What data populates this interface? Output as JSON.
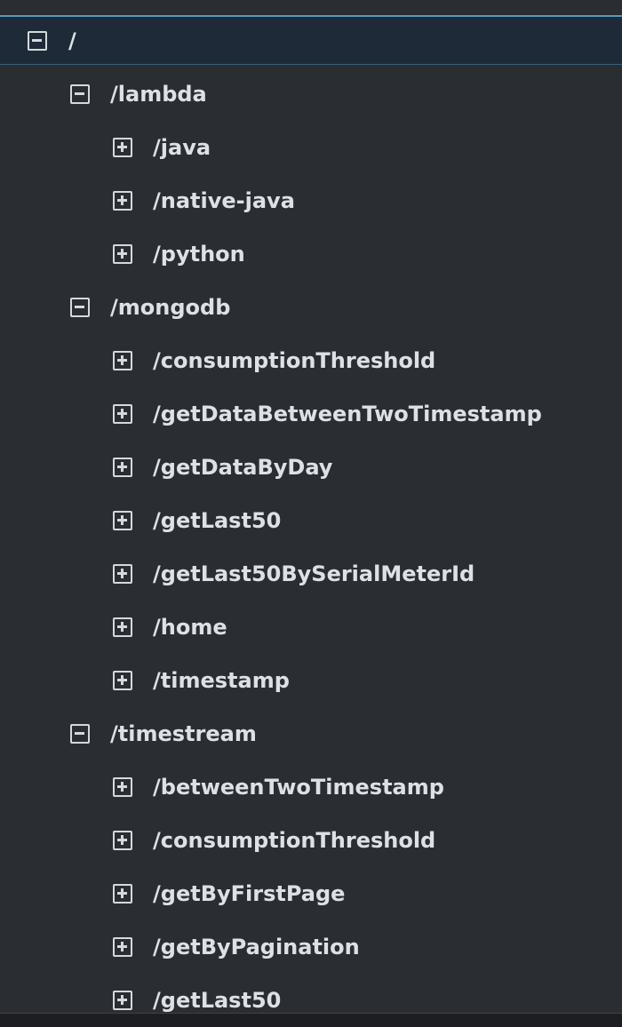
{
  "tree": {
    "nodes": [
      {
        "label": "/",
        "level": 0,
        "expanded": true,
        "selected": true
      },
      {
        "label": "/lambda",
        "level": 1,
        "expanded": true
      },
      {
        "label": "/java",
        "level": 2,
        "expanded": false
      },
      {
        "label": "/native-java",
        "level": 2,
        "expanded": false
      },
      {
        "label": "/python",
        "level": 2,
        "expanded": false
      },
      {
        "label": "/mongodb",
        "level": 1,
        "expanded": true
      },
      {
        "label": "/consumptionThreshold",
        "level": 2,
        "expanded": false
      },
      {
        "label": "/getDataBetweenTwoTimestamp",
        "level": 2,
        "expanded": false
      },
      {
        "label": "/getDataByDay",
        "level": 2,
        "expanded": false
      },
      {
        "label": "/getLast50",
        "level": 2,
        "expanded": false
      },
      {
        "label": "/getLast50BySerialMeterId",
        "level": 2,
        "expanded": false
      },
      {
        "label": "/home",
        "level": 2,
        "expanded": false
      },
      {
        "label": "/timestamp",
        "level": 2,
        "expanded": false
      },
      {
        "label": "/timestream",
        "level": 1,
        "expanded": true
      },
      {
        "label": "/betweenTwoTimestamp",
        "level": 2,
        "expanded": false
      },
      {
        "label": "/consumptionThreshold",
        "level": 2,
        "expanded": false
      },
      {
        "label": "/getByFirstPage",
        "level": 2,
        "expanded": false
      },
      {
        "label": "/getByPagination",
        "level": 2,
        "expanded": false
      },
      {
        "label": "/getLast50",
        "level": 2,
        "expanded": false
      }
    ]
  },
  "colors": {
    "background": "#2a2d32",
    "text": "#dde1e5",
    "selected_background": "#1e2a38",
    "selected_border": "#5b97c2"
  },
  "icons": {
    "expanded": "collapse-minus-icon",
    "collapsed": "expand-plus-icon"
  }
}
